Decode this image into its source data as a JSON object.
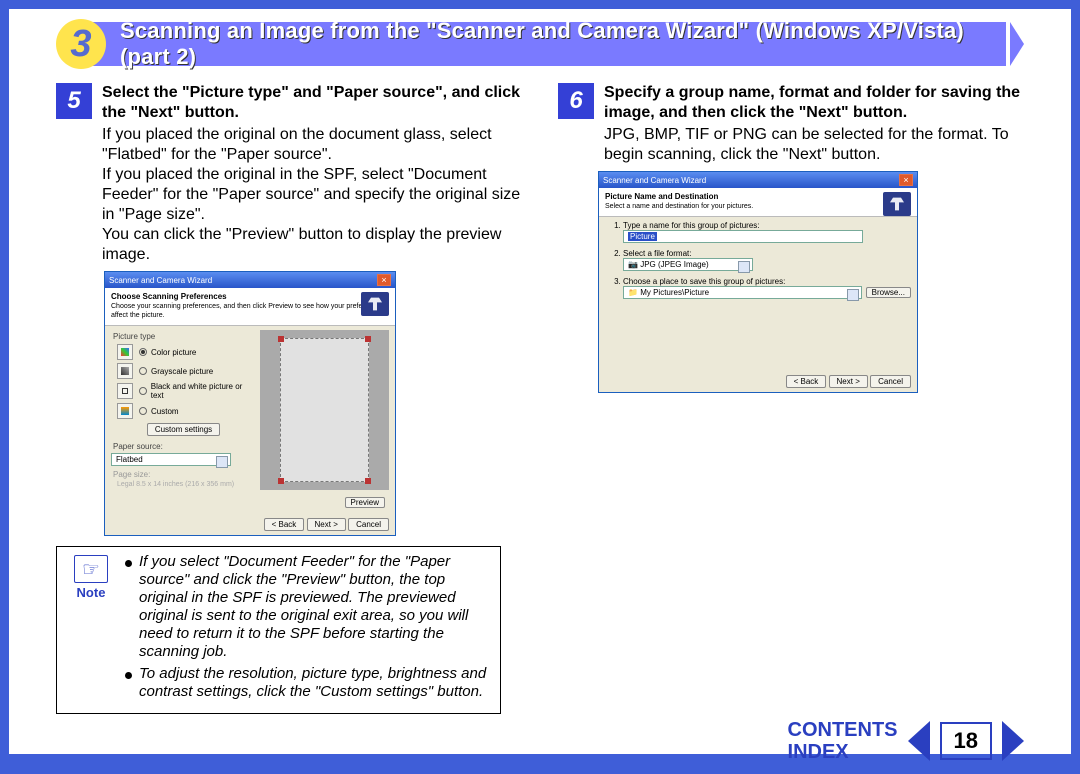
{
  "header": {
    "chapter_number": "3",
    "title": "Scanning an Image from the \"Scanner and Camera Wizard\" (Windows XP/Vista) (part 2)"
  },
  "left": {
    "step_number": "5",
    "heading": "Select the \"Picture type\" and \"Paper source\", and click the \"Next\" button.",
    "p1": "If you placed the original on the document glass, select \"Flatbed\" for the \"Paper source\".",
    "p2": "If you placed the original in the SPF, select \"Document Feeder\" for the \"Paper source\" and specify the original size in \"Page size\".",
    "p3": "You can click the \"Preview\" button to display the preview image.",
    "dialog": {
      "title": "Scanner and Camera Wizard",
      "section_title": "Choose Scanning Preferences",
      "section_sub": "Choose your scanning preferences, and then click Preview to see how your preferences affect the picture.",
      "pictype_label": "Picture type",
      "opt_color": "Color picture",
      "opt_gs": "Grayscale picture",
      "opt_bw": "Black and white picture or text",
      "opt_custom": "Custom",
      "custom_settings_btn": "Custom settings",
      "paper_source_label": "Paper source:",
      "paper_source_value": "Flatbed",
      "page_size_label": "Page size:",
      "page_size_value": "Legal 8.5 x 14 inches (216 x 356 mm)",
      "preview_btn": "Preview",
      "back_btn": "< Back",
      "next_btn": "Next >",
      "cancel_btn": "Cancel"
    }
  },
  "right": {
    "step_number": "6",
    "heading": "Specify a group name, format and folder for saving the image, and then click the \"Next\" button.",
    "p1": "JPG, BMP, TIF or PNG can be selected for the format. To begin scanning, click the \"Next\" button.",
    "dialog": {
      "title": "Scanner and Camera Wizard",
      "section_title": "Picture Name and Destination",
      "section_sub": "Select a name and destination for your pictures.",
      "q1": "Type a name for this group of pictures:",
      "name_value": "Picture",
      "q2": "Select a file format:",
      "format_value": "JPG (JPEG Image)",
      "q3": "Choose a place to save this group of pictures:",
      "folder_value": "My Pictures\\Picture",
      "browse_btn": "Browse...",
      "back_btn": "< Back",
      "next_btn": "Next >",
      "cancel_btn": "Cancel"
    }
  },
  "note": {
    "label": "Note",
    "bullet1": "If you select \"Document Feeder\" for the \"Paper source\" and click the \"Preview\" button, the top original in the SPF is previewed. The previewed original is sent to the original exit area, so you will need to return it to the SPF before starting the scanning job.",
    "bullet2": "To adjust the resolution, picture type, brightness and contrast settings, click the \"Custom settings\" button."
  },
  "nav": {
    "contents": "CONTENTS",
    "index": "INDEX",
    "page": "18"
  }
}
